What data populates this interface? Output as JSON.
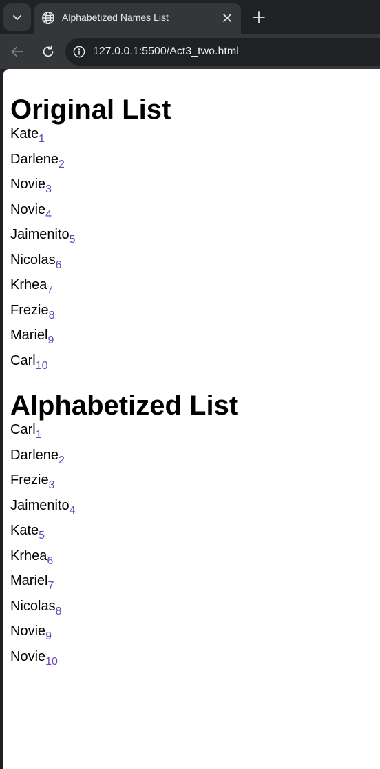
{
  "browser": {
    "tab": {
      "title": "Alphabetized Names List",
      "favicon": "globe-icon"
    },
    "toolbar": {
      "url": "127.0.0.1:5500/Act3_two.html"
    },
    "icons": {
      "tab_search": "chevron-down-icon",
      "close": "close-icon",
      "new_tab": "plus-icon",
      "back": "arrow-left-icon",
      "reload": "reload-icon",
      "site_info": "info-icon"
    }
  },
  "page": {
    "original": {
      "title": "Original List",
      "items": [
        {
          "name": "Kate",
          "num": "1"
        },
        {
          "name": "Darlene",
          "num": "2"
        },
        {
          "name": "Novie",
          "num": "3"
        },
        {
          "name": "Novie",
          "num": "4"
        },
        {
          "name": "Jaimenito",
          "num": "5"
        },
        {
          "name": "Nicolas",
          "num": "6"
        },
        {
          "name": "Krhea",
          "num": "7"
        },
        {
          "name": "Frezie",
          "num": "8"
        },
        {
          "name": "Mariel",
          "num": "9"
        },
        {
          "name": "Carl",
          "num": "10"
        }
      ]
    },
    "alphabetized": {
      "title": "Alphabetized List",
      "items": [
        {
          "name": "Carl",
          "num": "1"
        },
        {
          "name": "Darlene",
          "num": "2"
        },
        {
          "name": "Frezie",
          "num": "3"
        },
        {
          "name": "Jaimenito",
          "num": "4"
        },
        {
          "name": "Kate",
          "num": "5"
        },
        {
          "name": "Krhea",
          "num": "6"
        },
        {
          "name": "Mariel",
          "num": "7"
        },
        {
          "name": "Nicolas",
          "num": "8"
        },
        {
          "name": "Novie",
          "num": "9"
        },
        {
          "name": "Novie",
          "num": "10"
        }
      ]
    },
    "colors": {
      "subscript": "#6b45b8",
      "browser_chrome": "#202124",
      "toolbar": "#35363a"
    }
  }
}
